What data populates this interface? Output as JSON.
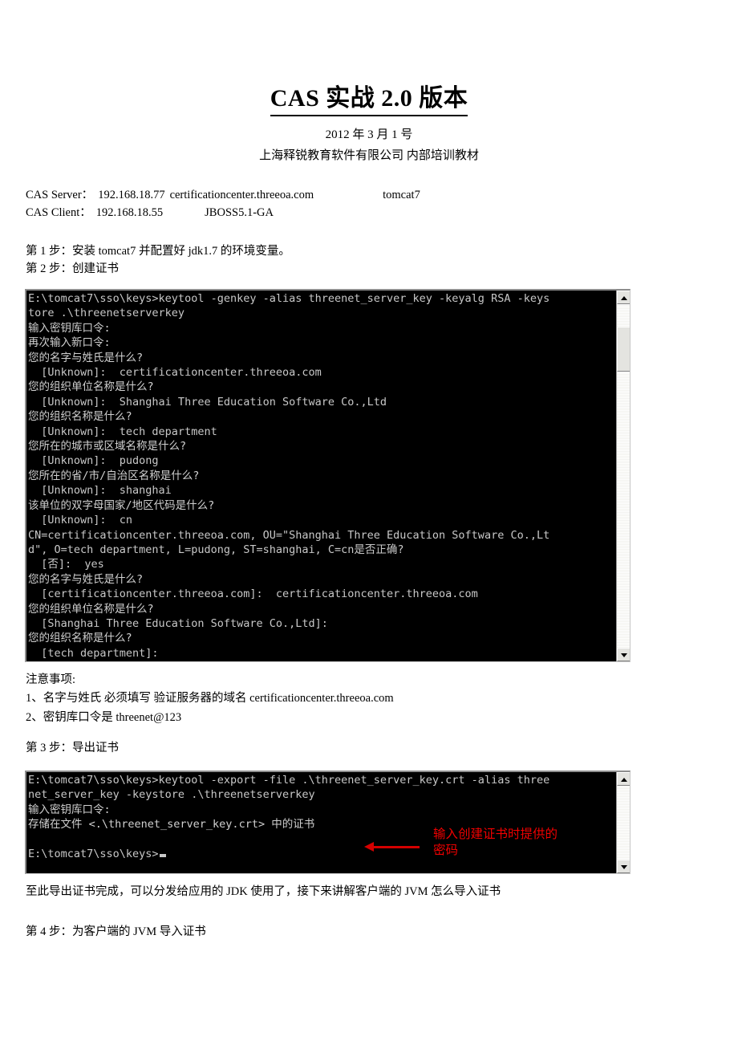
{
  "document": {
    "title": "CAS 实战 2.0 版本",
    "date": "2012 年 3 月 1 号",
    "org": "上海释锐教育软件有限公司  内部培训教材"
  },
  "env": {
    "server_label": "CAS Server：",
    "server_ip": "192.168.18.77",
    "server_domain": "certificationcenter.threeoa.com",
    "server_container": "tomcat7",
    "client_label": "CAS Client：",
    "client_ip": "192.168.18.55",
    "client_container": "JBOSS5.1-GA"
  },
  "steps": {
    "step1": "第 1 步：安装 tomcat7  并配置好 jdk1.7 的环境变量。",
    "step2": "第 2 步：创建证书",
    "step3": "第 3 步：导出证书",
    "step4": "第 4 步：为客户端的 JVM 导入证书"
  },
  "console1": {
    "name": "create-certificate-console",
    "lines": [
      "E:\\tomcat7\\sso\\keys>keytool -genkey -alias threenet_server_key -keyalg RSA -keys",
      "tore .\\threenetserverkey",
      "输入密钥库口令:",
      "再次输入新口令:",
      "您的名字与姓氏是什么?",
      "  [Unknown]:  certificationcenter.threeoa.com",
      "您的组织单位名称是什么?",
      "  [Unknown]:  Shanghai Three Education Software Co.,Ltd",
      "您的组织名称是什么?",
      "  [Unknown]:  tech department",
      "您所在的城市或区域名称是什么?",
      "  [Unknown]:  pudong",
      "您所在的省/市/自治区名称是什么?",
      "  [Unknown]:  shanghai",
      "该单位的双字母国家/地区代码是什么?",
      "  [Unknown]:  cn",
      "CN=certificationcenter.threeoa.com, OU=\"Shanghai Three Education Software Co.,Lt",
      "d\", O=tech department, L=pudong, ST=shanghai, C=cn是否正确?",
      "  [否]:  yes",
      "您的名字与姓氏是什么?",
      "  [certificationcenter.threeoa.com]:  certificationcenter.threeoa.com",
      "您的组织单位名称是什么?",
      "  [Shanghai Three Education Software Co.,Ltd]:",
      "您的组织名称是什么?",
      "  [tech department]:"
    ]
  },
  "notes": {
    "heading": "注意事项:",
    "item1": "1、名字与姓氏 必须填写 验证服务器的域名 certificationcenter.threeoa.com",
    "item2": "2、密钥库口令是 threenet@123"
  },
  "console2": {
    "name": "export-certificate-console",
    "lines": [
      "E:\\tomcat7\\sso\\keys>keytool -export -file .\\threenet_server_key.crt -alias three",
      "net_server_key -keystore .\\threenetserverkey",
      "输入密钥库口令:",
      "存储在文件 <.\\threenet_server_key.crt> 中的证书",
      "",
      "E:\\tomcat7\\sso\\keys>"
    ],
    "annotation": "输入创建证书时提供的\n密码",
    "annotation_color": "#f00000"
  },
  "footer": {
    "line1": "至此导出证书完成，可以分发给应用的 JDK 使用了，接下来讲解客户端的 JVM 怎么导入证书"
  },
  "icons": {
    "scroll_up": "scroll-up-arrow-icon",
    "scroll_down": "scroll-down-arrow-icon",
    "annotation_arrow": "red-left-arrow-icon",
    "caret": "console-cursor-icon"
  }
}
